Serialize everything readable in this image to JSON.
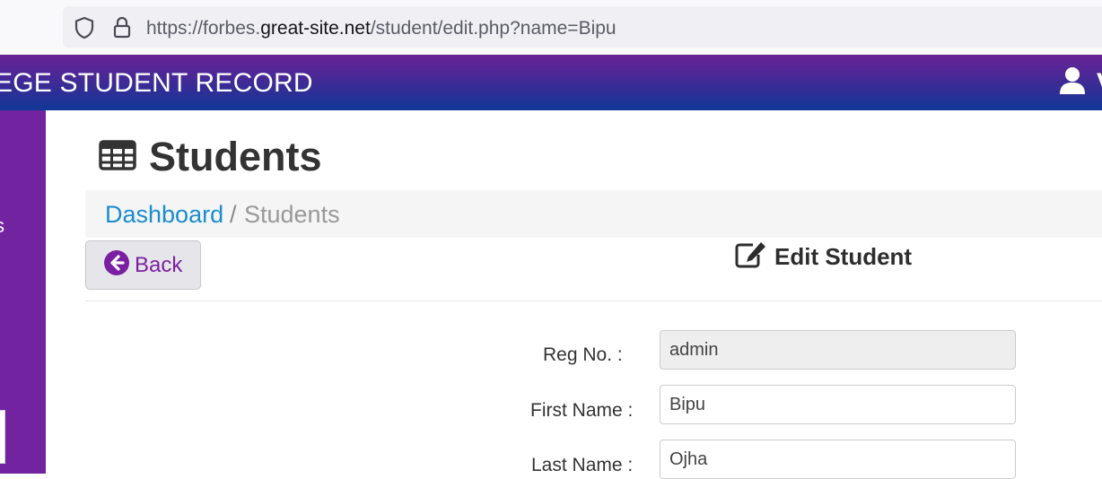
{
  "browser": {
    "url_prefix": "https://forbes.",
    "url_host": "great-site.net",
    "url_path": "/student/edit.php?name=Bipu",
    "icons": [
      "shield-icon",
      "lock-icon"
    ]
  },
  "header": {
    "app_title": "EGE STUDENT RECORD",
    "user_initial": "V",
    "user_icon": "user-icon",
    "gradient_colors": [
      "#6a2396",
      "#103896"
    ]
  },
  "sidebar": {
    "partial_text": "s",
    "color": "#7224a0"
  },
  "page": {
    "title": "Students",
    "title_icon": "table-icon"
  },
  "breadcrumb": {
    "dashboard": "Dashboard",
    "separator": "/",
    "current": "Students"
  },
  "actions": {
    "back_label": "Back",
    "back_icon": "arrow-left-circle-icon"
  },
  "form": {
    "heading": "Edit Student",
    "heading_icon": "edit-icon",
    "fields": [
      {
        "label": "Reg No. :",
        "value": "admin",
        "readonly": true
      },
      {
        "label": "First Name :",
        "value": "Bipu",
        "readonly": false
      },
      {
        "label": "Last Name :",
        "value": "Ojha",
        "readonly": false
      }
    ]
  },
  "colors": {
    "link": "#1a8ccf",
    "accent": "#7b1fa2"
  }
}
